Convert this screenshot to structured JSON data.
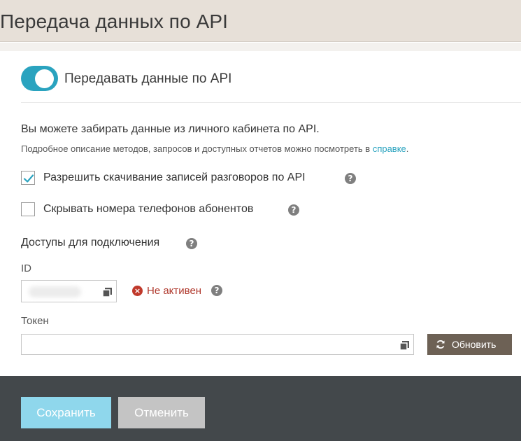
{
  "header": {
    "title": "Передача данных по API"
  },
  "api_toggle": {
    "label": "Передавать данные по API",
    "enabled": true
  },
  "intro": {
    "text": "Вы можете забирать данные из личного кабинета по API.",
    "help_prefix": "Подробное описание методов, запросов и доступных отчетов можно посмотреть в ",
    "help_link": "справке",
    "help_suffix": "."
  },
  "options": [
    {
      "label": "Разрешить скачивание записей разговоров по API",
      "checked": true
    },
    {
      "label": "Скрывать номера телефонов абонентов",
      "checked": false
    }
  ],
  "access": {
    "title": "Доступы для подключения",
    "id_label": "ID",
    "status": "Не активен",
    "token_label": "Токен",
    "token_value": "",
    "refresh_label": "Обновить"
  },
  "footer": {
    "save_label": "Сохранить",
    "cancel_label": "Отменить"
  },
  "colors": {
    "accent": "#2aa3bf",
    "error": "#b0392d",
    "header_bg": "#e7e0d8",
    "footer_bg": "#43484b",
    "refresh_bg": "#6d6155"
  }
}
